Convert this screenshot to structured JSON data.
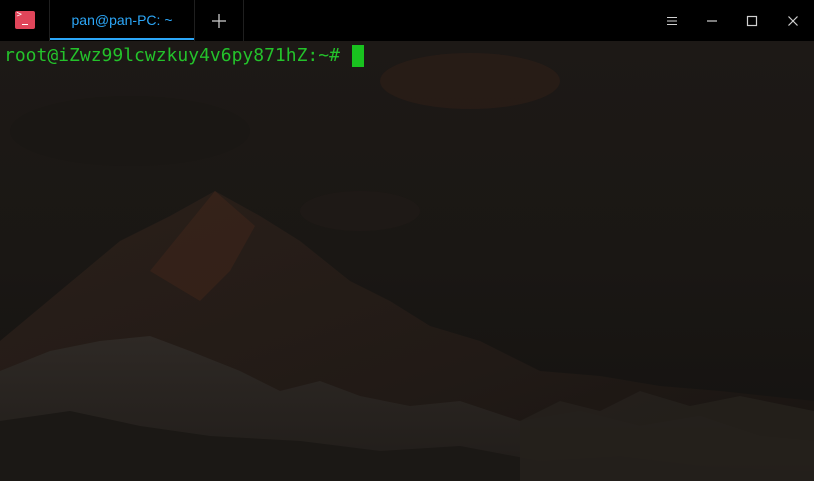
{
  "window": {
    "app_icon": "terminal-icon",
    "tabs": [
      {
        "label": "pan@pan-PC: ~",
        "active": true
      }
    ],
    "new_tab_icon": "plus-icon",
    "controls": {
      "menu_icon": "hamburger-menu-icon",
      "minimize_icon": "minimize-icon",
      "maximize_icon": "maximize-icon",
      "close_icon": "close-icon"
    }
  },
  "terminal": {
    "prompt": "root@iZwz99lcwzkuy4v6py871hZ:~#",
    "input": "",
    "cursor_color": "#19c21f",
    "prompt_color": "#24c22b"
  },
  "colors": {
    "titlebar": "#000000",
    "accent": "#2ca7f8",
    "app_icon": "#e0455a"
  }
}
